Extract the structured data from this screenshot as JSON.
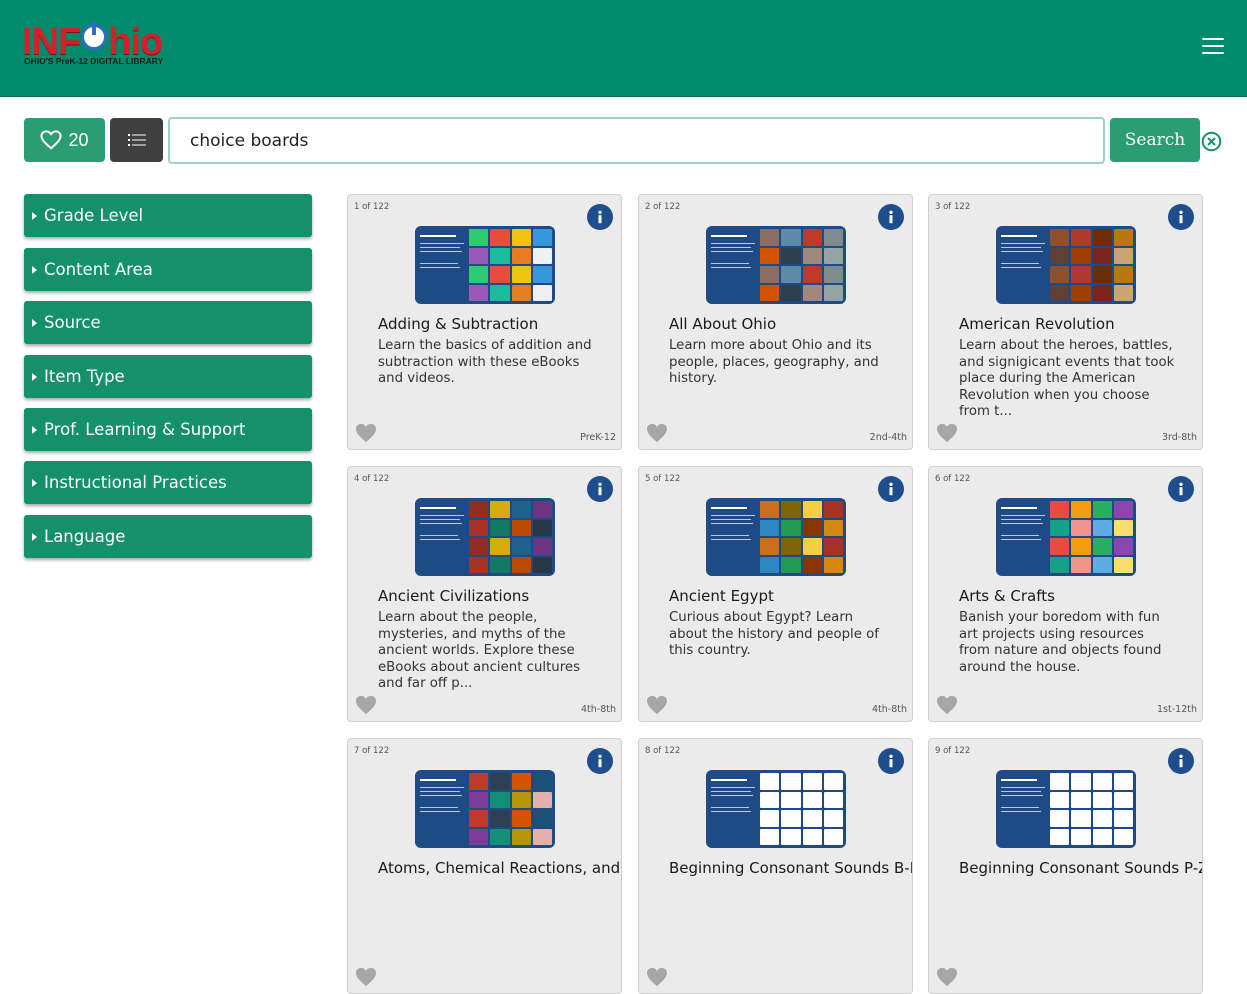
{
  "header": {
    "logo_text": "INFOhio",
    "logo_tagline": "OHIO'S PreK-12 DIGITAL LIBRARY",
    "menu_icon": "hamburger-menu-icon",
    "brand_color": "#008c6c",
    "logo_color": "#d4202a"
  },
  "toolbar": {
    "favorites_count": "20",
    "favorites_icon": "heart-outline-icon",
    "list_icon": "list-view-icon",
    "search_value": "choice boards",
    "search_label": "Search",
    "clear_icon": "clear-circle-icon",
    "accent_color": "#2a9d72"
  },
  "facets": [
    {
      "label": "Grade Level"
    },
    {
      "label": "Content Area"
    },
    {
      "label": "Source"
    },
    {
      "label": "Item Type"
    },
    {
      "label": "Prof. Learning & Support"
    },
    {
      "label": "Instructional Practices"
    },
    {
      "label": "Language"
    }
  ],
  "results": [
    {
      "count": "1 of 122",
      "title": "Adding & Subtraction",
      "description": "Learn the basics of addition and subtraction with these eBooks and videos.",
      "grade": "PreK-12"
    },
    {
      "count": "2 of 122",
      "title": "All About Ohio",
      "description": "Learn more about Ohio and its people, places, geography, and history.",
      "grade": "2nd-4th"
    },
    {
      "count": "3 of 122",
      "title": "American Revolution",
      "description": "Learn about the heroes, battles, and signigicant events that took place during the American Revolution when you choose from t...",
      "grade": "3rd-8th"
    },
    {
      "count": "4 of 122",
      "title": "Ancient Civilizations",
      "description": "Learn about the people, mysteries, and myths of the ancient worlds. Explore these eBooks about ancient cultures and far off p...",
      "grade": "4th-8th"
    },
    {
      "count": "5 of 122",
      "title": "Ancient Egypt",
      "description": "Curious about Egypt? Learn about the history and people of this country.",
      "grade": "4th-8th"
    },
    {
      "count": "6 of 122",
      "title": "Arts & Crafts",
      "description": "Banish your boredom with fun art projects using resources from nature and objects found around the house.",
      "grade": "1st-12th"
    },
    {
      "count": "7 of 122",
      "title": "Atoms, Chemical Reactions, and States of Matter",
      "description": "",
      "grade": ""
    },
    {
      "count": "8 of 122",
      "title": "Beginning Consonant Sounds B-N",
      "description": "",
      "grade": ""
    },
    {
      "count": "9 of 122",
      "title": "Beginning Consonant Sounds P-Z",
      "description": "",
      "grade": ""
    }
  ]
}
